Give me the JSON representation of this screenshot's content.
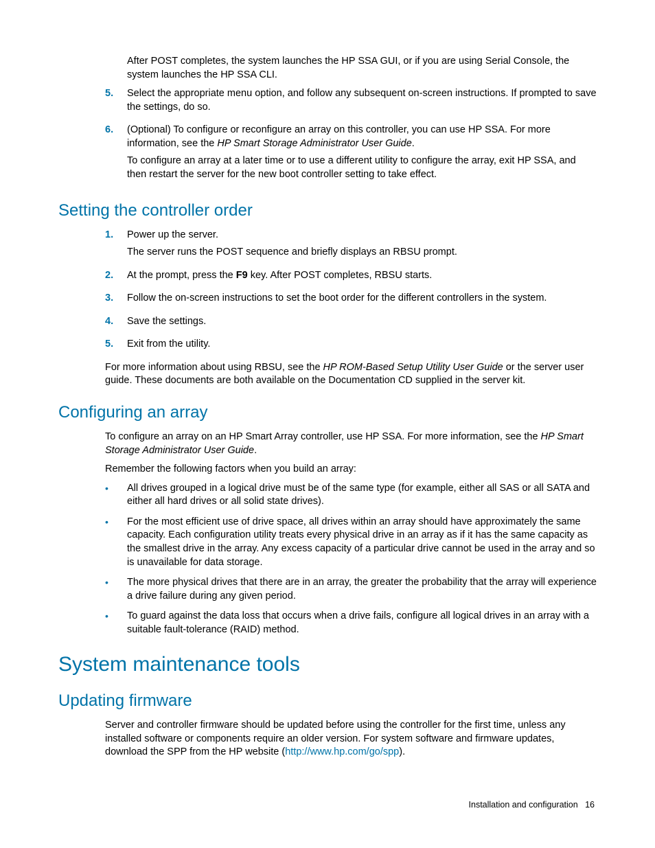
{
  "intro": "After POST completes, the system launches the HP SSA GUI, or if you are using Serial Console, the system launches the HP SSA CLI.",
  "intro_list": [
    {
      "num": "5.",
      "paras": [
        "Select the appropriate menu option, and follow any subsequent on-screen instructions. If prompted to save the settings, do so."
      ]
    },
    {
      "num": "6.",
      "paras": [
        "(Optional) To configure or reconfigure an array on this controller, you can use HP SSA. For more information, see the <span class=\"em\">HP Smart Storage Administrator User Guide</span>.",
        "To configure an array at a later time or to use a different utility to configure the array, exit HP SSA, and then restart the server for the new boot controller setting to take effect."
      ]
    }
  ],
  "sec1": {
    "title": "Setting the controller order",
    "list": [
      {
        "num": "1.",
        "paras": [
          "Power up the server.",
          "The server runs the POST sequence and briefly displays an RBSU prompt."
        ]
      },
      {
        "num": "2.",
        "paras": [
          "At the prompt, press the <span class=\"bold\">F9</span> key. After POST completes, RBSU starts."
        ]
      },
      {
        "num": "3.",
        "paras": [
          "Follow the on-screen instructions to set the boot order for the different controllers in the system."
        ]
      },
      {
        "num": "4.",
        "paras": [
          "Save the settings."
        ]
      },
      {
        "num": "5.",
        "paras": [
          "Exit from the utility."
        ]
      }
    ],
    "after": "For more information about using RBSU, see the <span class=\"em\">HP ROM-Based Setup Utility User Guide</span> or the server user guide. These documents are both available on the Documentation CD supplied in the server kit."
  },
  "sec2": {
    "title": "Configuring an array",
    "p1": "To configure an array on an HP Smart Array controller, use HP SSA. For more information, see the <span class=\"em\">HP Smart Storage Administrator User Guide</span>.",
    "p2": "Remember the following factors when you build an array:",
    "bullets": [
      "All drives grouped in a logical drive must be of the same type (for example, either all SAS or all SATA and either all hard drives or all solid state drives).",
      "For the most efficient use of drive space, all drives within an array should have approximately the same capacity. Each configuration utility treats every physical drive in an array as if it has the same capacity as the smallest drive in the array. Any excess capacity of a particular drive cannot be used in the array and so is unavailable for data storage.",
      "The more physical drives that there are in an array, the greater the probability that the array will experience a drive failure during any given period.",
      "To guard against the data loss that occurs when a drive fails, configure all logical drives in an array with a suitable fault-tolerance (RAID) method."
    ]
  },
  "sec3": {
    "title": "System maintenance tools",
    "sub": {
      "title": "Updating firmware",
      "p": "Server and controller firmware should be updated before using the controller for the first time, unless any installed software or components require an older version. For system software and firmware updates, download the SPP from the HP website (<span class=\"link\">http://www.hp.com/go/spp</span>)."
    }
  },
  "footer": {
    "section": "Installation and configuration",
    "page": "16"
  }
}
